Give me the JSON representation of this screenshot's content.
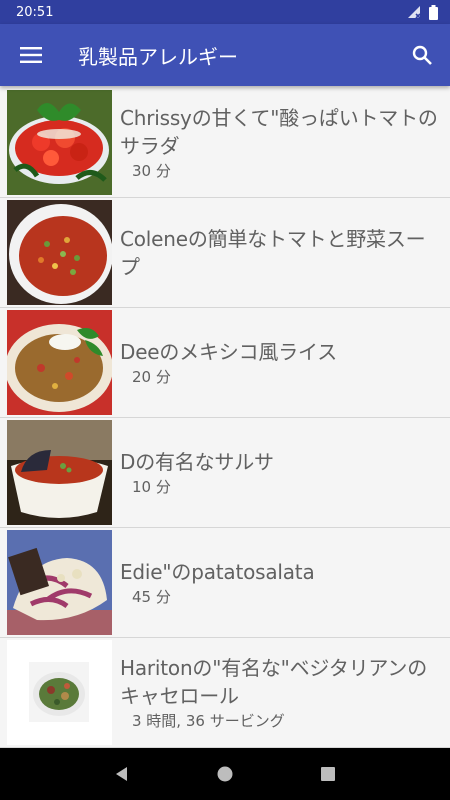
{
  "status_bar": {
    "time": "20:51"
  },
  "app_bar": {
    "title": "乳製品アレルギー"
  },
  "recipes": [
    {
      "title": "Chrissyの甘くて\"酸っぱいトマトのサラダ",
      "subtitle": "30 分",
      "thumbnail": "tomato-salad"
    },
    {
      "title": "Coleneの簡単なトマトと野菜スープ",
      "subtitle": "",
      "thumbnail": "vegetable-soup"
    },
    {
      "title": "Deeのメキシコ風ライス",
      "subtitle": "20 分",
      "thumbnail": "mexican-rice"
    },
    {
      "title": "Dの有名なサルサ",
      "subtitle": "10 分",
      "thumbnail": "salsa"
    },
    {
      "title": "Edie\"のpatatosalata",
      "subtitle": "45 分",
      "thumbnail": "potato-salad"
    },
    {
      "title": "Haritonの\"有名な\"ベジタリアンのキャセロール",
      "subtitle": "3 時間, 36 サービング",
      "thumbnail": "vegetarian-casserole"
    }
  ],
  "colors": {
    "status_bar": "#303f9f",
    "app_bar": "#3f51b5",
    "text": "#616161"
  }
}
